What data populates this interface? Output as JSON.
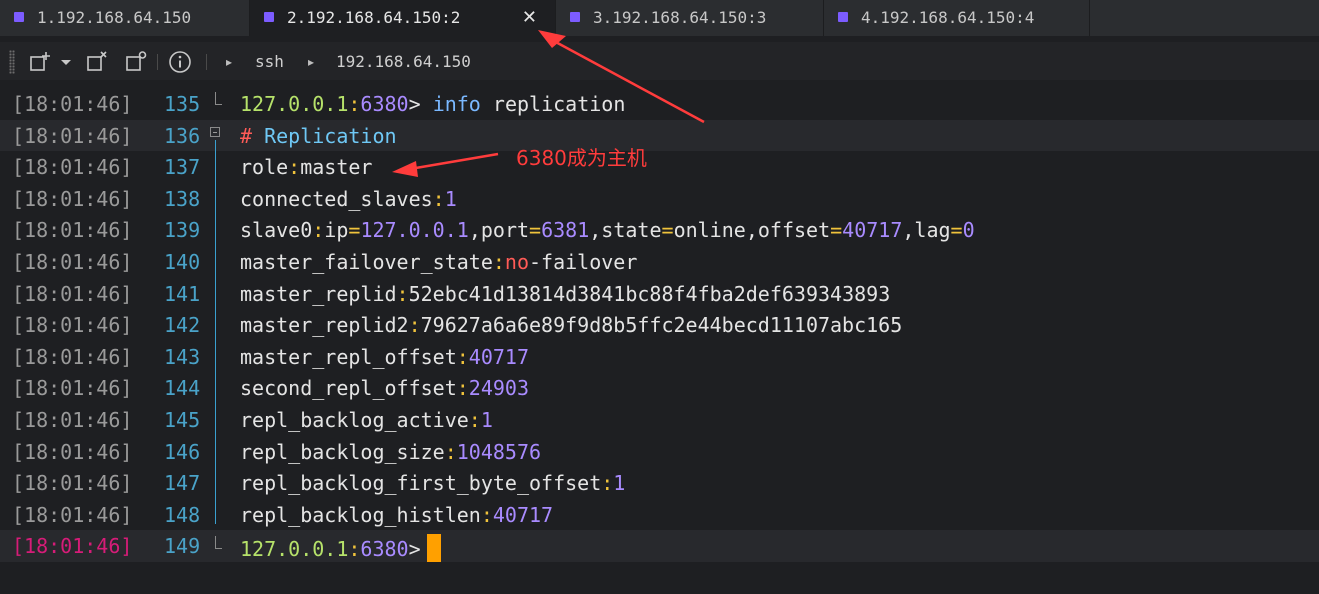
{
  "tabs": [
    {
      "label": "1.192.168.64.150",
      "active": false
    },
    {
      "label": "2.192.168.64.150:2",
      "active": true
    },
    {
      "label": "3.192.168.64.150:3",
      "active": false
    },
    {
      "label": "4.192.168.64.150:4",
      "active": false
    }
  ],
  "tab_close_glyph": "✕",
  "toolbar": {
    "breadcrumb": [
      "ssh",
      "192.168.64.150"
    ]
  },
  "lines": [
    {
      "ts": "[18:01:46]",
      "ln": "135"
    },
    {
      "ts": "[18:01:46]",
      "ln": "136"
    },
    {
      "ts": "[18:01:46]",
      "ln": "137"
    },
    {
      "ts": "[18:01:46]",
      "ln": "138"
    },
    {
      "ts": "[18:01:46]",
      "ln": "139"
    },
    {
      "ts": "[18:01:46]",
      "ln": "140"
    },
    {
      "ts": "[18:01:46]",
      "ln": "141"
    },
    {
      "ts": "[18:01:46]",
      "ln": "142"
    },
    {
      "ts": "[18:01:46]",
      "ln": "143"
    },
    {
      "ts": "[18:01:46]",
      "ln": "144"
    },
    {
      "ts": "[18:01:46]",
      "ln": "145"
    },
    {
      "ts": "[18:01:46]",
      "ln": "146"
    },
    {
      "ts": "[18:01:46]",
      "ln": "147"
    },
    {
      "ts": "[18:01:46]",
      "ln": "148"
    },
    {
      "ts": "[18:01:46]",
      "ln": "149"
    }
  ],
  "code": {
    "l135": {
      "prompt_host": "127.0.0.1",
      "prompt_port": "6380",
      "prompt_gt": ">",
      "cmd1": "info",
      "cmd2": "replication"
    },
    "l136": {
      "hash": "#",
      "title": "Replication"
    },
    "l137": {
      "key": "role",
      "val": "master"
    },
    "l138": {
      "key": "connected_slaves",
      "val": "1"
    },
    "l139": {
      "key": "slave0",
      "ipk": "ip",
      "ipv": "127.0.0.1",
      "portk": "port",
      "portv": "6381",
      "statek": "state",
      "statev": "online",
      "offk": "offset",
      "offv": "40717",
      "lagk": "lag",
      "lagv": "0"
    },
    "l140": {
      "key": "master_failover_state",
      "val1": "no",
      "val2": "-failover"
    },
    "l141": {
      "key": "master_replid",
      "val": "52ebc41d13814d3841bc88f4fba2def639343893"
    },
    "l142": {
      "key": "master_replid2",
      "val": "79627a6a6e89f9d8b5ffc2e44becd11107abc165"
    },
    "l143": {
      "key": "master_repl_offset",
      "val": "40717"
    },
    "l144": {
      "key": "second_repl_offset",
      "val": "24903"
    },
    "l145": {
      "key": "repl_backlog_active",
      "val": "1"
    },
    "l146": {
      "key": "repl_backlog_size",
      "val": "1048576"
    },
    "l147": {
      "key": "repl_backlog_first_byte_offset",
      "val": "1"
    },
    "l148": {
      "key": "repl_backlog_histlen",
      "val": "40717"
    },
    "l149": {
      "prompt_host": "127.0.0.1",
      "prompt_port": "6380",
      "prompt_gt": ">"
    }
  },
  "annotation": "6380成为主机",
  "colors": {
    "accent": "#7c5cff",
    "cursor": "#ffa000",
    "annotation": "#ff3c3c",
    "timestamp_current": "#d61c78"
  }
}
